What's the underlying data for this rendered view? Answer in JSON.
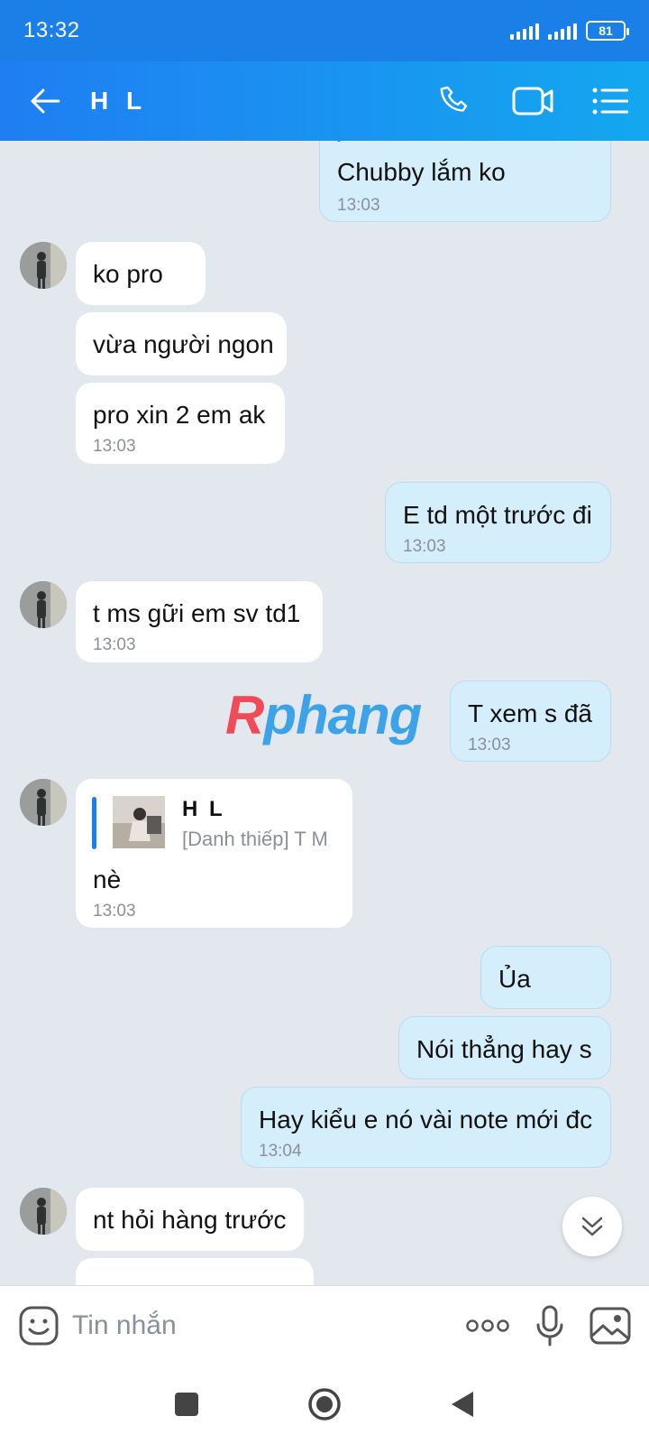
{
  "status_bar": {
    "time": "13:32",
    "battery": "81"
  },
  "header": {
    "title": "H L"
  },
  "watermark": {
    "first": "R",
    "rest": "phang"
  },
  "messages": [
    {
      "dir": "out",
      "text": "Chubby lắm ko",
      "time": "13:03"
    },
    {
      "dir": "in",
      "text": "ko pro"
    },
    {
      "dir": "in",
      "text": "vừa người ngon"
    },
    {
      "dir": "in",
      "text": "pro xin 2 em ak",
      "time": "13:03"
    },
    {
      "dir": "out",
      "text": "E td một trước đi",
      "time": "13:03"
    },
    {
      "dir": "in",
      "text": "t ms gữi em sv td1",
      "time": "13:03"
    },
    {
      "dir": "out",
      "text": "T xem s đã",
      "time": "13:03"
    },
    {
      "dir": "in",
      "card_name": "H L",
      "card_desc": "[Danh thiếp] T M",
      "text": "nè",
      "time": "13:03"
    },
    {
      "dir": "out",
      "text": "Ủa"
    },
    {
      "dir": "out",
      "text": "Nói thẳng hay s"
    },
    {
      "dir": "out",
      "text": "Hay kiểu e nó vài note mới đc",
      "time": "13:04"
    },
    {
      "dir": "in",
      "text": "nt hỏi hàng trước"
    }
  ],
  "input": {
    "placeholder": "Tin nhắn"
  }
}
